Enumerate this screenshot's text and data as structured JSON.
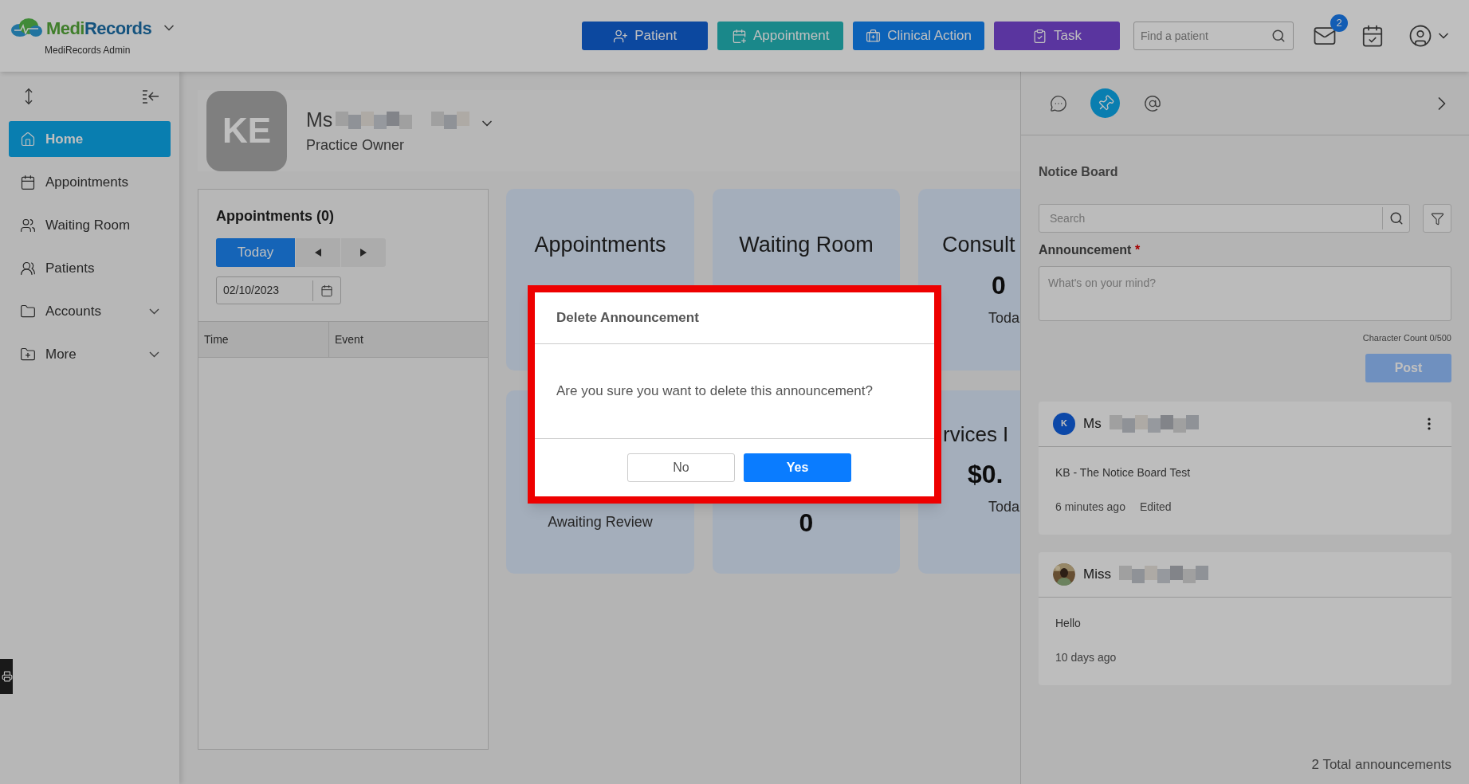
{
  "header": {
    "logo": {
      "first": "Medi",
      "second": "Records"
    },
    "subtitle": "MediRecords Admin",
    "actions": [
      {
        "label": "Patient"
      },
      {
        "label": "Appointment"
      },
      {
        "label": "Clinical Action"
      },
      {
        "label": "Task"
      }
    ],
    "search": {
      "placeholder": "Find a patient"
    },
    "mail_badge": "2"
  },
  "sidebar": {
    "items": [
      {
        "label": "Home",
        "selected": true,
        "expandable": false
      },
      {
        "label": "Appointments",
        "selected": false,
        "expandable": false
      },
      {
        "label": "Waiting Room",
        "selected": false,
        "expandable": false
      },
      {
        "label": "Patients",
        "selected": false,
        "expandable": false
      },
      {
        "label": "Accounts",
        "selected": false,
        "expandable": true
      },
      {
        "label": "More",
        "selected": false,
        "expandable": true
      }
    ]
  },
  "profile": {
    "initials": "KE",
    "salutation": "Ms",
    "role": "Practice Owner"
  },
  "appointments_panel": {
    "title": "Appointments (0)",
    "today": "Today",
    "date": "02/10/2023",
    "columns": [
      "Time",
      "Event"
    ]
  },
  "cards": [
    {
      "title": "Appointments"
    },
    {
      "title": "Waiting Room"
    },
    {
      "title": "Consult",
      "value": "0",
      "caption": "Toda"
    },
    {
      "caption": "Awaiting Review"
    },
    {
      "value": "0"
    },
    {
      "title": "rvices I",
      "value": "$0.",
      "caption": "Toda"
    }
  ],
  "notice_board": {
    "tabs": [
      {
        "kind": "chat",
        "selected": false
      },
      {
        "kind": "pin",
        "selected": true
      },
      {
        "kind": "mention",
        "selected": false
      }
    ],
    "title": "Notice Board",
    "search": {
      "placeholder": "Search"
    },
    "announcement_label": "Announcement",
    "required_mark": "*",
    "textarea": {
      "placeholder": "What's on your mind?"
    },
    "char_count": "Character Count 0/500",
    "post": {
      "label": "Post",
      "disabled": true
    },
    "posts": [
      {
        "author": "Ms",
        "avatar": {
          "kind": "initial",
          "text": "K"
        },
        "body": "KB - The Notice Board Test",
        "time": "6 minutes ago",
        "edited": "Edited",
        "menu": true
      },
      {
        "author": "Miss",
        "body": "Hello",
        "time": "10 days ago",
        "menu": false
      }
    ],
    "total": "2 Total announcements"
  },
  "dialog": {
    "title": "Delete Announcement",
    "message": "Are you sure you want to delete this announcement?",
    "buttons": [
      {
        "label": "No",
        "kind": "secondary"
      },
      {
        "label": "Yes",
        "kind": "primary"
      }
    ]
  }
}
